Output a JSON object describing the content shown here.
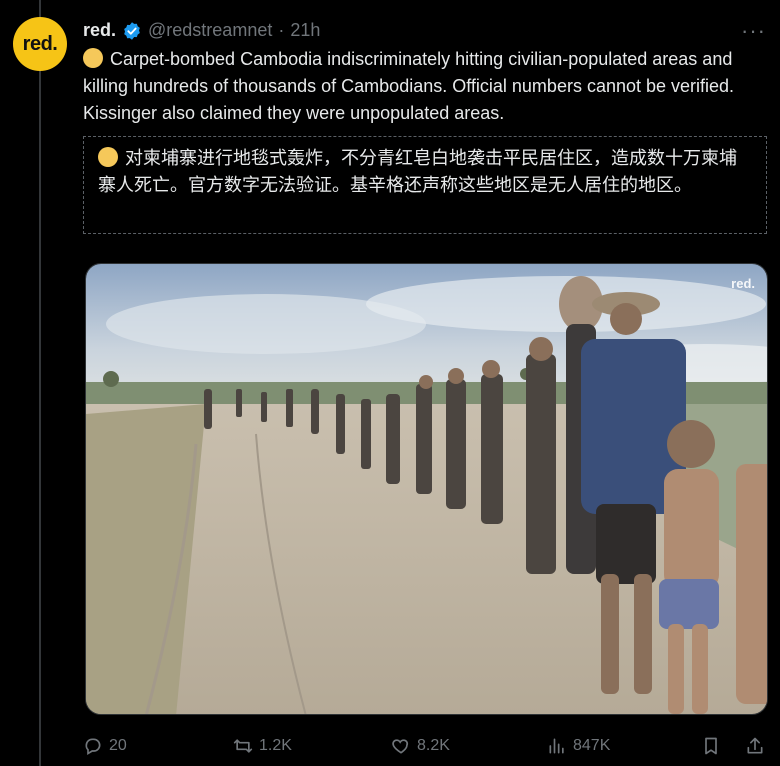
{
  "post": {
    "avatar_text": "red.",
    "display_name": "red.",
    "handle": "@redstreamnet",
    "separator": "·",
    "time": "21h",
    "more_label": "···",
    "text": "Carpet-bombed Cambodia indiscriminately hitting civilian-populated areas and killing hundreds of thousands of Cambodians. Official numbers cannot be verified. Kissinger also claimed they were unpopulated areas.",
    "translation": "对柬埔寨进行地毯式轰炸，不分青红皂白地袭击平民居住区，造成数十万柬埔寨人死亡。官方数字无法验证。基辛格还声称这些地区是无人居住的地区。",
    "image": {
      "watermark": "red."
    }
  },
  "actions": {
    "replies": "20",
    "reposts": "1.2K",
    "likes": "8.2K",
    "views": "847K"
  },
  "colors": {
    "background": "#000000",
    "text": "#e7e9ea",
    "muted": "#71767b",
    "verified": "#1d9bf0",
    "avatar": "#f6c416"
  }
}
